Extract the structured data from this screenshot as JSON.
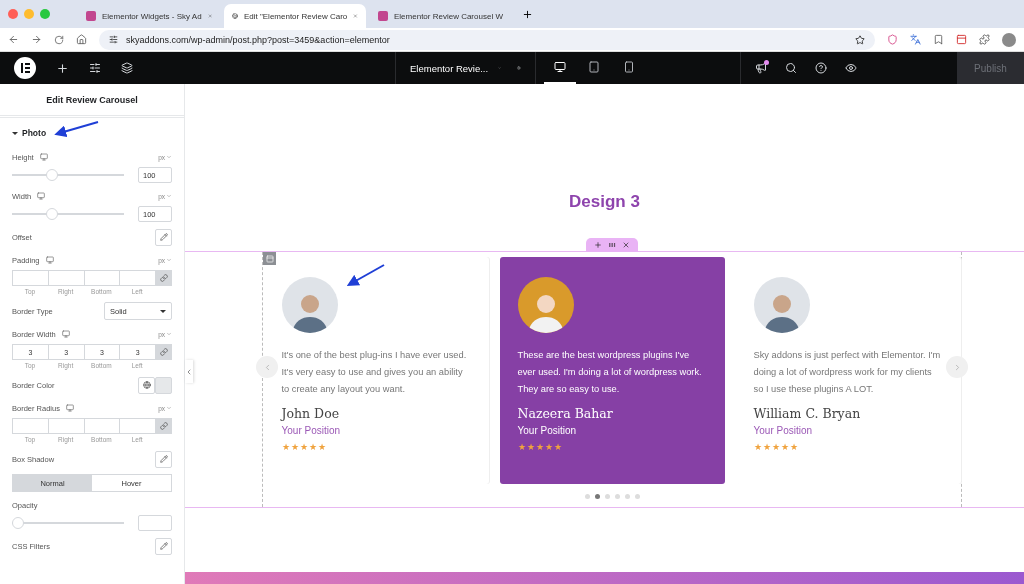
{
  "browser": {
    "tabs": [
      {
        "title": "Elementor Widgets - Sky Ad",
        "selected": false
      },
      {
        "title": "Edit \"Elementor Review Caro",
        "selected": true
      },
      {
        "title": "Elementor Review Carousel W",
        "selected": false
      }
    ],
    "url": "skyaddons.com/wp-admin/post.php?post=3459&action=elementor"
  },
  "editor_bar": {
    "document_title": "Elementor Revie...",
    "devices": [
      {
        "kind": "desktop",
        "selected": true
      },
      {
        "kind": "tablet",
        "selected": false
      },
      {
        "kind": "mobile",
        "selected": false
      }
    ],
    "publish": {
      "label": "Publish",
      "disabled": true
    }
  },
  "panel": {
    "title": "Edit Review Carousel",
    "section": {
      "title": "Photo",
      "expanded": true
    },
    "controls": [
      {
        "kind": "slider",
        "label": "Height",
        "responsive": true,
        "unit": "px",
        "value": "100",
        "level": 0.34
      },
      {
        "kind": "slider",
        "label": "Width",
        "responsive": true,
        "unit": "px",
        "value": "100",
        "level": 0.34
      },
      {
        "kind": "popover",
        "label": "Offset"
      },
      {
        "kind": "dimensions",
        "label": "Padding",
        "responsive": true,
        "unit": "px",
        "fields": [
          {
            "label": "Top"
          },
          {
            "label": "Right"
          },
          {
            "label": "Bottom"
          },
          {
            "label": "Left"
          }
        ]
      },
      {
        "kind": "select",
        "label": "Border Type",
        "value": "Solid"
      },
      {
        "kind": "dimensions",
        "label": "Border Width",
        "responsive": true,
        "unit": "px",
        "fields": [
          {
            "label": "Top",
            "value": "3"
          },
          {
            "label": "Right",
            "value": "3"
          },
          {
            "label": "Bottom",
            "value": "3"
          },
          {
            "label": "Left",
            "value": "3"
          }
        ]
      },
      {
        "kind": "color",
        "label": "Border Color"
      },
      {
        "kind": "dimensions",
        "label": "Border Radius",
        "responsive": true,
        "unit": "px",
        "fields": [
          {
            "label": "Top"
          },
          {
            "label": "Right"
          },
          {
            "label": "Bottom"
          },
          {
            "label": "Left"
          }
        ]
      },
      {
        "kind": "popover",
        "label": "Box Shadow"
      },
      {
        "kind": "tabs",
        "tabs": [
          {
            "label": "Normal",
            "selected": true
          },
          {
            "label": "Hover",
            "selected": false
          }
        ]
      },
      {
        "kind": "slider",
        "label": "Opacity",
        "responsive": false,
        "level": 0
      },
      {
        "kind": "popover",
        "label": "CSS Filters"
      }
    ]
  },
  "canvas": {
    "heading": "Design 3",
    "reviews": [
      {
        "text": "It's one of the best plug-ins I have ever used. It's very easy to use and gives you an ability to create any layout you want.",
        "name": "John Doe",
        "position": "Your Position",
        "stars": 5,
        "highlighted": false
      },
      {
        "text": "These are the best wordpress plugins I've ever used. I'm doing a lot of wordpress work. They are so easy to use.",
        "name": "Nazeera Bahar",
        "position": "Your Position",
        "stars": 5,
        "highlighted": true
      },
      {
        "text": "Sky addons is just perfect with Elementor. I'm doing a lot of wordpress work for my clients so I use these plugins A LOT.",
        "name": "William C. Bryan",
        "position": "Your Position",
        "stars": 5,
        "highlighted": false
      }
    ],
    "dots": [
      {
        "selected": false
      },
      {
        "selected": true
      },
      {
        "selected": false
      },
      {
        "selected": false
      },
      {
        "selected": false
      },
      {
        "selected": false
      }
    ]
  }
}
